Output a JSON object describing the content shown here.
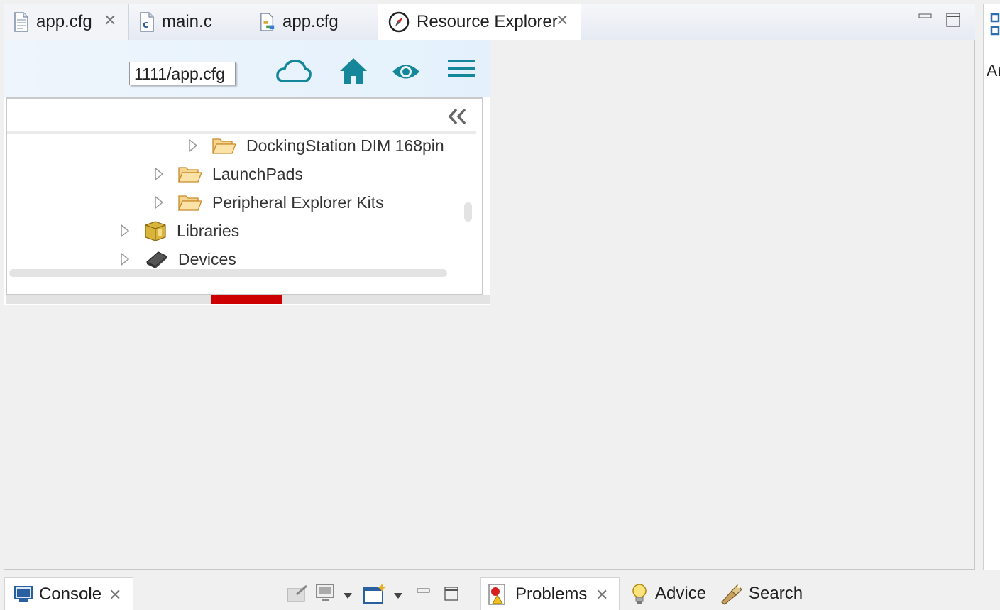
{
  "editor_tabs": [
    {
      "label": "app.cfg",
      "icon": "text-file-icon",
      "closable": true
    },
    {
      "label": "main.c",
      "icon": "c-source-file-icon",
      "closable": false
    },
    {
      "label": "app.cfg",
      "icon": "rtos-config-file-icon",
      "closable": false
    },
    {
      "label": "Resource Explorer",
      "icon": "compass-icon",
      "closable": true,
      "active": true
    }
  ],
  "resource_explorer": {
    "path_tooltip": "1111/app.cfg",
    "toolbar_icons": [
      "cloud-icon",
      "home-icon",
      "eye-icon",
      "menu-icon"
    ],
    "collapse_icon": "double-chevron-left-icon",
    "tree": [
      {
        "label": "DockingStation DIM 168pin",
        "icon": "folder-open-icon"
      },
      {
        "label": "LaunchPads",
        "icon": "folder-open-icon"
      },
      {
        "label": "Peripheral Explorer Kits",
        "icon": "folder-open-icon"
      },
      {
        "label": "Libraries",
        "icon": "library-icon"
      },
      {
        "label": "Devices",
        "icon": "chip-icon"
      }
    ]
  },
  "right_panel": {
    "text": "Ar"
  },
  "bottom_tabs": [
    {
      "label": "Console",
      "icon": "console-icon",
      "closable": true
    },
    {
      "label": "Problems",
      "icon": "problems-icon",
      "closable": true
    },
    {
      "label": "Advice",
      "icon": "lightbulb-icon"
    },
    {
      "label": "Search",
      "icon": "flashlight-icon"
    }
  ],
  "colors": {
    "accent_teal": "#14889a",
    "error_red": "#cc0000"
  }
}
